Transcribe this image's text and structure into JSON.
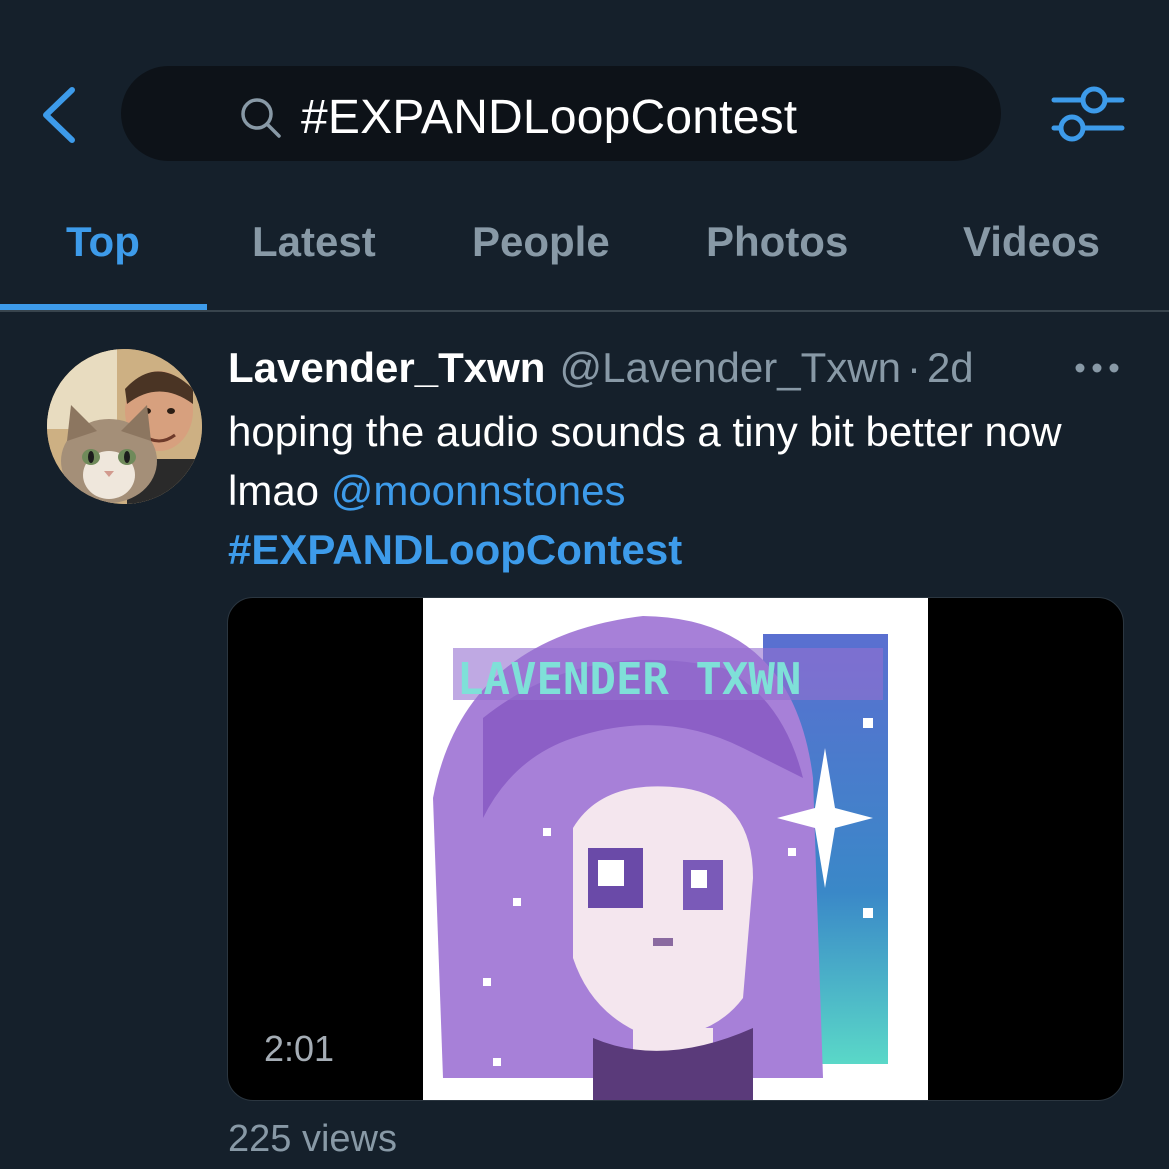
{
  "search": {
    "query": "#EXPANDLoopContest"
  },
  "tabs": [
    {
      "label": "Top",
      "active": true
    },
    {
      "label": "Latest",
      "active": false
    },
    {
      "label": "People",
      "active": false
    },
    {
      "label": "Photos",
      "active": false
    },
    {
      "label": "Videos",
      "active": false
    }
  ],
  "tweet": {
    "name": "Lavender_Txwn",
    "handle": "@Lavender_Txwn",
    "separator": "·",
    "time": "2d",
    "text_plain": "hoping the audio sounds a tiny bit better now lmao ",
    "mention": "@moonnstones",
    "hashtag": "#EXPANDLoopContest",
    "video": {
      "duration": "2:01",
      "artwork_text": "LAVENDER TXWN"
    },
    "views": "225 views"
  },
  "colors": {
    "background": "#15202b",
    "accent": "#3d9bea",
    "secondary_text": "#8899a6",
    "search_bg": "#0d1218",
    "divider": "#38444d"
  },
  "icons": [
    "back-chevron-icon",
    "search-icon",
    "filter-sliders-icon",
    "more-dots-icon"
  ]
}
